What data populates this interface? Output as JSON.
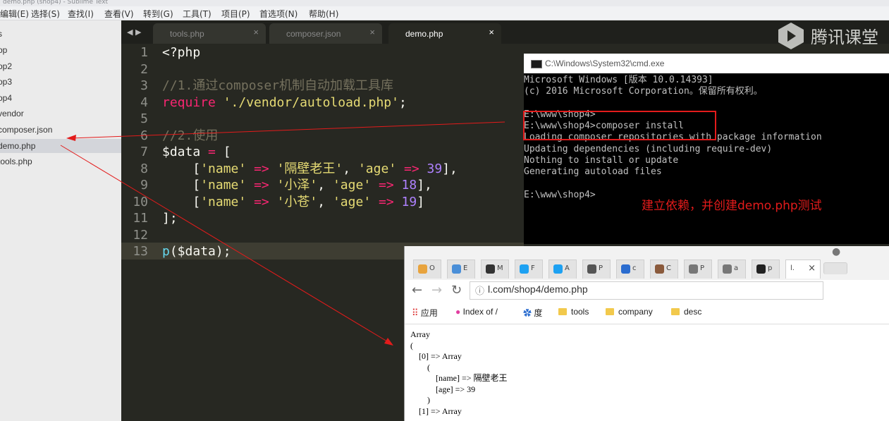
{
  "window_title": "demo.php (shop4) - Sublime Text",
  "menu": [
    "编辑(E)",
    "选择(S)",
    "查找(I)",
    "查看(V)",
    "转到(G)",
    "工具(T)",
    "项目(P)",
    "首选项(N)",
    "帮助(H)"
  ],
  "sidebar": {
    "items": [
      {
        "label": "s"
      },
      {
        "label": "op"
      },
      {
        "label": "op2"
      },
      {
        "label": "op3"
      },
      {
        "label": "op4"
      },
      {
        "label": "vendor"
      },
      {
        "label": "composer.json"
      },
      {
        "label": "demo.php"
      },
      {
        "label": "tools.php"
      }
    ]
  },
  "editor": {
    "tabs": [
      {
        "label": "tools.php",
        "close": "×"
      },
      {
        "label": "composer.json",
        "close": "×"
      },
      {
        "label": "demo.php",
        "close": "×"
      }
    ],
    "line_numbers": [
      "1",
      "2",
      "3",
      "4",
      "5",
      "6",
      "7",
      "8",
      "9",
      "10",
      "11",
      "12",
      "13"
    ],
    "code": {
      "l1": "<?php",
      "l3": "//1.通过composer机制自动加载工具库",
      "l4_kw": "require",
      "l4_str": "'./vendor/autoload.php'",
      "l4_end": ";",
      "l6": "//2.使用",
      "l7_var": "$data",
      "l7_op": " = ",
      "l7_br": "[",
      "row1_name": "'隔壁老王'",
      "row1_age": "39",
      "row2_name": "'小泽'",
      "row2_age": "18",
      "row3_name": "'小苍'",
      "row3_age": "19",
      "key_name": "'name'",
      "key_age": "'age'",
      "arrow": "=>",
      "l11": "];",
      "l13_fn": "p",
      "l13_rest": "($data);"
    }
  },
  "watermark": "腾讯课堂",
  "cmd": {
    "title": "C:\\Windows\\System32\\cmd.exe",
    "lines": [
      "Microsoft Windows [版本 10.0.14393]",
      "(c) 2016 Microsoft Corporation。保留所有权利。",
      "",
      "E:\\www\\shop4>",
      "E:\\www\\shop4>composer install",
      "Loading composer repositories with package information",
      "Updating dependencies (including require-dev)",
      "Nothing to install or update",
      "Generating autoload files",
      "",
      "E:\\www\\shop4>"
    ],
    "annotation": "建立依赖，并创建demo.php测试"
  },
  "browser": {
    "tabs": [
      "O",
      "E",
      "M",
      "F",
      "A",
      "P",
      "c",
      "C",
      "P",
      "a",
      "p",
      "l."
    ],
    "tab_colors": [
      "#e8a33d",
      "#4a8fd8",
      "#333333",
      "#1da1f2",
      "#1da1f2",
      "#555555",
      "#2a6ccf",
      "#8a5a3c",
      "#777777",
      "#777777",
      "#222222",
      "#ffffff"
    ],
    "url": "l.com/shop4/demo.php",
    "bookmarks": {
      "apps": "应用",
      "index": "Index of /",
      "du": "度",
      "tools": "tools",
      "company": "company",
      "desc": "desc"
    },
    "output": [
      "Array",
      "(",
      "    [0] => Array",
      "        (",
      "            [name] => 隔壁老王",
      "            [age] => 39",
      "        )",
      "",
      "    [1] => Array"
    ]
  }
}
